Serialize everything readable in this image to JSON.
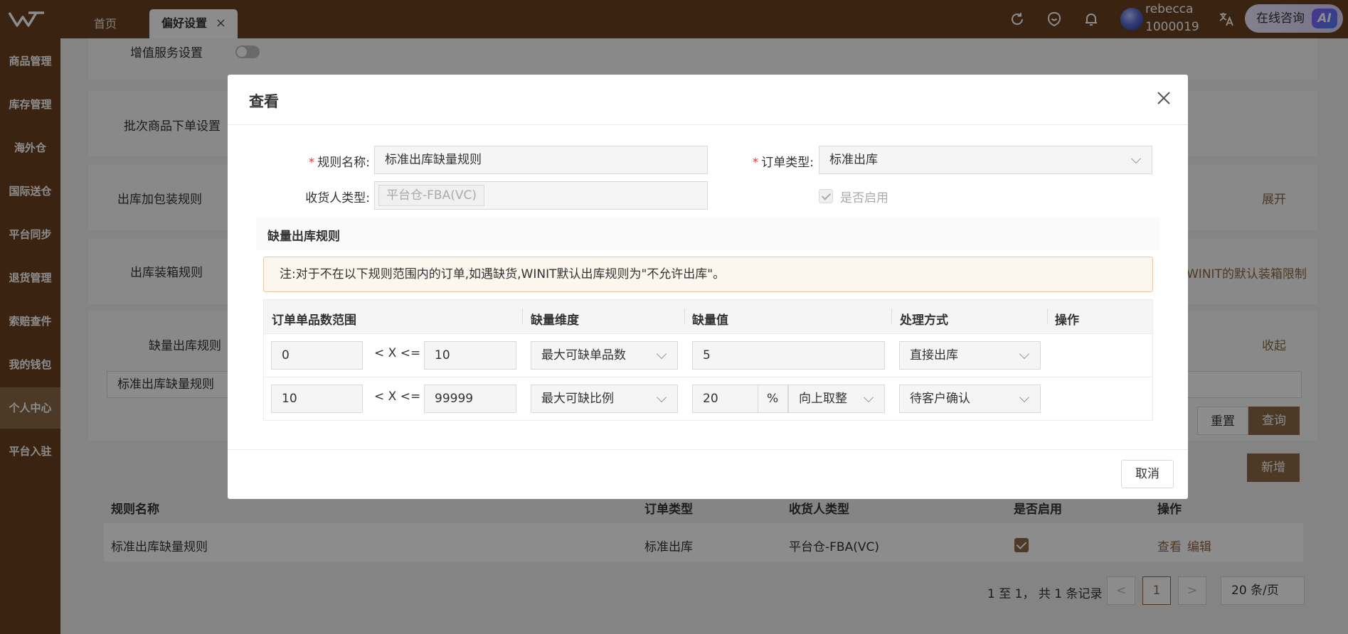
{
  "topbar": {
    "tabs": [
      {
        "label": "首页"
      },
      {
        "label": "偏好设置"
      }
    ],
    "tab_close_glyph": "×",
    "user": {
      "name": "rebecca",
      "id": "1000019"
    },
    "ai_button": {
      "label": "在线咨询",
      "badge": "AI"
    },
    "icons": [
      "refresh-icon",
      "message-icon",
      "bell-icon",
      "translate-icon"
    ]
  },
  "sidebar": {
    "items": [
      {
        "label": "商品管理"
      },
      {
        "label": "库存管理"
      },
      {
        "label": "海外仓"
      },
      {
        "label": "国际送仓"
      },
      {
        "label": "平台同步"
      },
      {
        "label": "退货管理"
      },
      {
        "label": "索赔查件"
      },
      {
        "label": "我的钱包"
      },
      {
        "label": "个人中心"
      },
      {
        "label": "平台入驻"
      }
    ],
    "active_index": 8
  },
  "background": {
    "value_added_label": "增值服务设置",
    "batch_label": "批次商品下单设置",
    "packaging_label": "出库加包装规则",
    "expand_label": "展开",
    "boxing_label": "出库装箱规则",
    "boxing_note": "WINIT的默认装箱限制",
    "shortage_label": "缺量出库规则",
    "collapse_label": "收起",
    "search_value": "标准出库缺量规则",
    "reset_label": "重置",
    "query_label": "查询",
    "add_label": "新增",
    "table": {
      "headers": [
        "规则名称",
        "订单类型",
        "收货人类型",
        "是否启用",
        "操作"
      ],
      "rows": [
        {
          "name": "标准出库缺量规则",
          "order_type": "标准出库",
          "receiver_type": "平台仓-FBA(VC)",
          "enabled": true,
          "view": "查看",
          "edit": "编辑"
        }
      ]
    },
    "pagination": {
      "summary": "1 至 1，  共 1 条记录",
      "current_page": "1",
      "prev": "<",
      "next": ">",
      "page_size": "20 条/页"
    }
  },
  "modal": {
    "title": "查看",
    "rule_name_label": "规则名称:",
    "rule_name_value": "标准出库缺量规则",
    "order_type_label": "订单类型:",
    "order_type_value": "标准出库",
    "receiver_type_label": "收货人类型:",
    "receiver_type_tag": "平台仓-FBA(VC)",
    "enabled_label": "是否启用",
    "section_title": "缺量出库规则",
    "notice": "注:对于不在以下规则范围内的订单,如遇缺货,WINIT默认出库规则为\"不允许出库\"。",
    "grid_headers": [
      "订单单品数范围",
      "缺量维度",
      "缺量值",
      "处理方式",
      "操作"
    ],
    "rows": [
      {
        "min": "0",
        "op": "< X <=",
        "max": "10",
        "dimension": "最大可缺单品数",
        "value": "5",
        "unit": "",
        "rounding": "",
        "handling": "直接出库"
      },
      {
        "min": "10",
        "op": "< X <=",
        "max": "99999",
        "dimension": "最大可缺比例",
        "value": "20",
        "unit": "%",
        "rounding": "向上取整",
        "handling": "待客户确认"
      }
    ],
    "cancel_label": "取消"
  },
  "colors": {
    "brand": "#6b4320",
    "accent": "#8b6a47",
    "required": "#e53935"
  }
}
